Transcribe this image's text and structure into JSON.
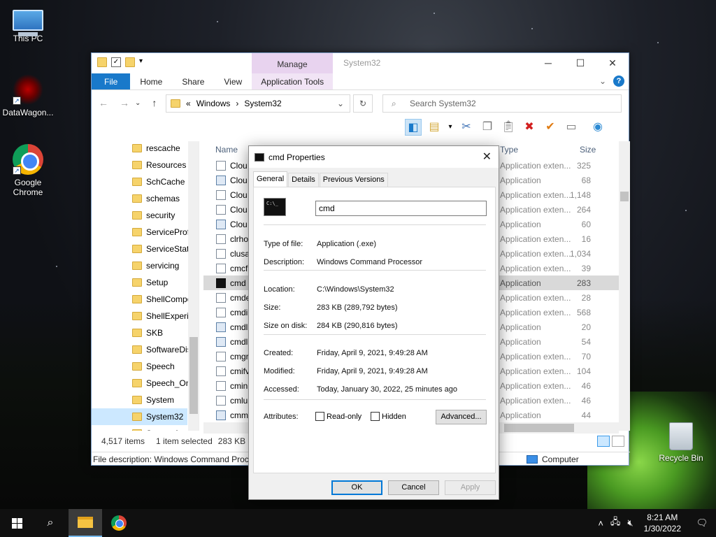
{
  "desktop": {
    "icons": [
      {
        "label": "This PC"
      },
      {
        "label": "DataWagon..."
      },
      {
        "label": "Google Chrome"
      },
      {
        "label": "Recycle Bin"
      }
    ]
  },
  "explorer": {
    "ribbon": {
      "manage": "Manage",
      "title": "System32",
      "tabs": [
        "File",
        "Home",
        "Share",
        "View",
        "Application Tools"
      ]
    },
    "address": {
      "parts": [
        "«",
        "Windows",
        "›",
        "System32"
      ],
      "search_placeholder": "Search System32"
    },
    "nav_pane": [
      "rescache",
      "Resources",
      "SchCache",
      "schemas",
      "security",
      "ServiceProfi",
      "ServiceState",
      "servicing",
      "Setup",
      "ShellCompo",
      "ShellExperie",
      "SKB",
      "SoftwareDis",
      "Speech",
      "Speech_One",
      "System",
      "System32",
      "SystemApps"
    ],
    "nav_selected": "System32",
    "columns": {
      "name": "Name",
      "type": "Type",
      "size": "Size"
    },
    "files": [
      {
        "name": "Clou",
        "type": "Application exten...",
        "size": "325",
        "icon": "dll"
      },
      {
        "name": "Clou",
        "type": "Application",
        "size": "68",
        "icon": "exe"
      },
      {
        "name": "Clou",
        "type": "Application exten...",
        "size": "1,148",
        "icon": "dll"
      },
      {
        "name": "Clou",
        "type": "Application exten...",
        "size": "264",
        "icon": "dll"
      },
      {
        "name": "Clou",
        "type": "Application",
        "size": "60",
        "icon": "exe"
      },
      {
        "name": "clrho",
        "type": "Application exten...",
        "size": "16",
        "icon": "dll"
      },
      {
        "name": "clusa",
        "type": "Application exten...",
        "size": "1,034",
        "icon": "dll"
      },
      {
        "name": "cmcf",
        "type": "Application exten...",
        "size": "39",
        "icon": "dll"
      },
      {
        "name": "cmd",
        "type": "Application",
        "size": "283",
        "icon": "cmd"
      },
      {
        "name": "cmde",
        "type": "Application exten...",
        "size": "28",
        "icon": "dll"
      },
      {
        "name": "cmdi",
        "type": "Application exten...",
        "size": "568",
        "icon": "dll"
      },
      {
        "name": "cmdl",
        "type": "Application",
        "size": "20",
        "icon": "exe"
      },
      {
        "name": "cmdl",
        "type": "Application",
        "size": "54",
        "icon": "exe"
      },
      {
        "name": "cmgr",
        "type": "Application exten...",
        "size": "70",
        "icon": "dll"
      },
      {
        "name": "cmifv",
        "type": "Application exten...",
        "size": "104",
        "icon": "dll"
      },
      {
        "name": "cmin",
        "type": "Application exten...",
        "size": "46",
        "icon": "dll"
      },
      {
        "name": "cmlu",
        "type": "Application exten...",
        "size": "46",
        "icon": "dll"
      },
      {
        "name": "cmm",
        "type": "Application",
        "size": "44",
        "icon": "exe"
      }
    ],
    "selected_file": "cmd",
    "status": {
      "items": "4,517 items",
      "selected": "1 item selected",
      "size": "283 KB"
    },
    "description": "File description: Windows Command Proc",
    "location_label": "Computer"
  },
  "dialog": {
    "title": "cmd Properties",
    "tabs": [
      "General",
      "Details",
      "Previous Versions"
    ],
    "active_tab": "General",
    "name_value": "cmd",
    "icon_text": "C:\\_",
    "props": [
      {
        "label": "Type of file:",
        "value": "Application (.exe)"
      },
      {
        "label": "Description:",
        "value": "Windows Command Processor"
      },
      {
        "label": "Location:",
        "value": "C:\\Windows\\System32"
      },
      {
        "label": "Size:",
        "value": "283 KB (289,792 bytes)"
      },
      {
        "label": "Size on disk:",
        "value": "284 KB (290,816 bytes)"
      },
      {
        "label": "Created:",
        "value": "Friday, April 9, 2021, 9:49:28 AM"
      },
      {
        "label": "Modified:",
        "value": "Friday, April 9, 2021, 9:49:28 AM"
      },
      {
        "label": "Accessed:",
        "value": "Today, January 30, 2022, 25 minutes ago"
      }
    ],
    "attributes_label": "Attributes:",
    "readonly_label": "Read-only",
    "readonly_checked": false,
    "hidden_label": "Hidden",
    "hidden_checked": false,
    "advanced_label": "Advanced...",
    "ok_label": "OK",
    "cancel_label": "Cancel",
    "apply_label": "Apply"
  },
  "taskbar": {
    "time": "8:21 AM",
    "date": "1/30/2022"
  }
}
